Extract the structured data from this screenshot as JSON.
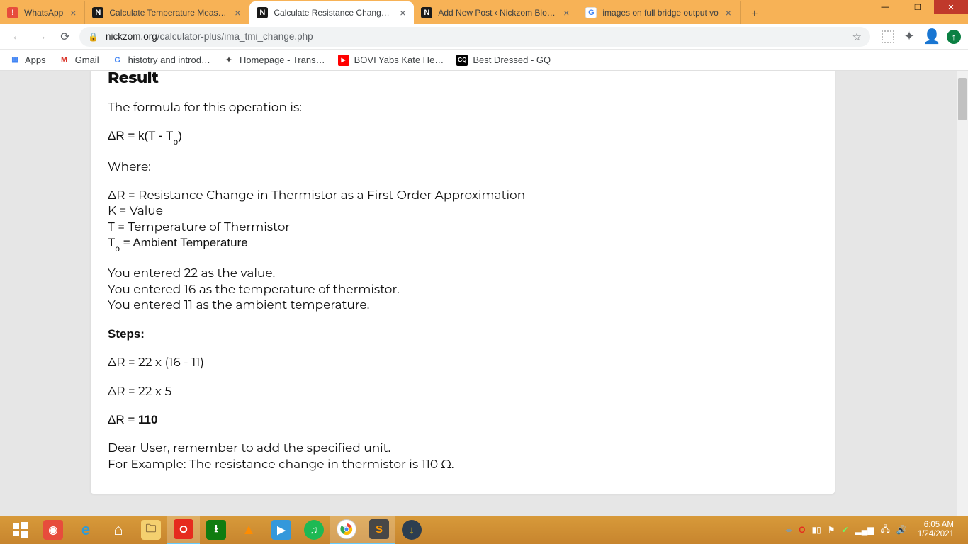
{
  "browser": {
    "tabs": [
      {
        "title": "WhatsApp",
        "favicon_bg": "#e74c3c",
        "favicon_txt": "!",
        "active": false
      },
      {
        "title": "Calculate Temperature Measurin",
        "favicon_bg": "#1a1a1a",
        "favicon_txt": "N",
        "active": false
      },
      {
        "title": "Calculate Resistance Change of",
        "favicon_bg": "#1a1a1a",
        "favicon_txt": "N",
        "active": true
      },
      {
        "title": "Add New Post ‹ Nickzom Blog —",
        "favicon_bg": "#1a1a1a",
        "favicon_txt": "N",
        "active": false
      },
      {
        "title": "images on full bridge output vo",
        "favicon_bg": "#ffffff",
        "favicon_txt": "G",
        "favicon_color": "#4285f4",
        "active": false
      }
    ],
    "url_domain": "nickzom.org",
    "url_path": "/calculator-plus/ima_tmi_change.php",
    "bookmarks": [
      {
        "label": "Apps",
        "ico_txt": "⋮⋮⋮",
        "ico_color": "linear"
      },
      {
        "label": "Gmail",
        "ico_txt": "M",
        "ico_bg": "#fff",
        "ico_color": "#d93025"
      },
      {
        "label": "histotry and introd…",
        "ico_txt": "G",
        "ico_bg": "#fff",
        "ico_color": "#4285f4"
      },
      {
        "label": "Homepage - Trans…",
        "ico_txt": "✦",
        "ico_bg": "#fff",
        "ico_color": "#444"
      },
      {
        "label": "BOVI Yabs Kate He…",
        "ico_txt": "▶",
        "ico_bg": "#ff0000",
        "ico_color": "#fff"
      },
      {
        "label": "Best Dressed - GQ",
        "ico_txt": "GQ",
        "ico_bg": "#000",
        "ico_color": "#fff"
      }
    ]
  },
  "content": {
    "heading": "Result",
    "intro": "The formula for this operation is:",
    "formula": "ΔR = k(T - T",
    "formula_sub": "o",
    "formula_close": ")",
    "where_label": "Where:",
    "defs": {
      "d1": "ΔR = Resistance Change in Thermistor as a First Order Approximation",
      "d2": "K = Value",
      "d3": "T = Temperature of Thermistor",
      "d4a": "T",
      "d4sub": "o",
      "d4b": " = Ambient Temperature"
    },
    "entered": {
      "e1": "You entered 22 as the value.",
      "e2": "You entered 16 as the temperature of thermistor.",
      "e3": "You entered 11 as the ambient temperature."
    },
    "steps_label": "Steps:",
    "steps": {
      "s1": "ΔR = 22 x (16 - 11)",
      "s2": "ΔR = 22 x 5",
      "s3a": "ΔR = ",
      "s3b": "110"
    },
    "footer": {
      "f1": "Dear User, remember to add the specified unit.",
      "f2": "For Example: The resistance change in thermistor is 110 Ω."
    }
  },
  "taskbar": {
    "time": "6:05 AM",
    "date": "1/24/2021"
  }
}
